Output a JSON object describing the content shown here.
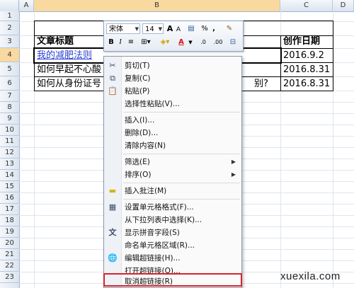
{
  "columns": [
    "A",
    "B",
    "C",
    "D"
  ],
  "rows": [
    "1",
    "2",
    "3",
    "4",
    "5",
    "6",
    "7",
    "8",
    "9",
    "10",
    "11",
    "12",
    "13",
    "14",
    "15",
    "16",
    "17",
    "18",
    "19",
    "20",
    "21",
    "22",
    "23"
  ],
  "cells": {
    "b3": "文章标题",
    "c3": "创作日期",
    "b4": "我的减肥法则",
    "c4": "2016.9.2",
    "b5": "如何早起不心酸",
    "c5": "2016.8.31",
    "b6": "如何从身份证号",
    "b6_tail": "别?",
    "c6": "2016.8.31"
  },
  "mini_toolbar": {
    "font_name": "宋体",
    "font_size": "14",
    "grow_font": "A",
    "shrink_font": "A",
    "percent": "%",
    "comma": ",",
    "bold": "B",
    "italic": "I",
    "font_color": "A",
    "increase_decimal": ".0",
    "decrease_decimal": ".00"
  },
  "context_menu": {
    "items": [
      {
        "label": "剪切(T)",
        "icon": "scissors-icon"
      },
      {
        "label": "复制(C)",
        "icon": "copy-icon"
      },
      {
        "label": "粘贴(P)",
        "icon": "paste-icon"
      },
      {
        "label": "选择性粘贴(V)..."
      },
      {
        "label": "插入(I)..."
      },
      {
        "label": "删除(D)..."
      },
      {
        "label": "清除内容(N)"
      },
      {
        "label": "筛选(E)",
        "submenu": true
      },
      {
        "label": "排序(O)",
        "submenu": true
      },
      {
        "label": "插入批注(M)",
        "icon": "comment-icon"
      },
      {
        "label": "设置单元格格式(F)...",
        "icon": "format-cells-icon"
      },
      {
        "label": "从下拉列表中选择(K)..."
      },
      {
        "label": "显示拼音字段(S)",
        "icon": "phonetic-icon"
      },
      {
        "label": "命名单元格区域(R)..."
      },
      {
        "label": "编辑超链接(H)...",
        "icon": "hyperlink-icon"
      },
      {
        "label": "打开超链接(O)..."
      },
      {
        "label": "取消超链接(R)"
      }
    ]
  },
  "watermark": "xuexila.com",
  "colors": {
    "highlight": "#d8232a",
    "link": "#2a3fd0",
    "selected_header": "#f9d99f"
  }
}
